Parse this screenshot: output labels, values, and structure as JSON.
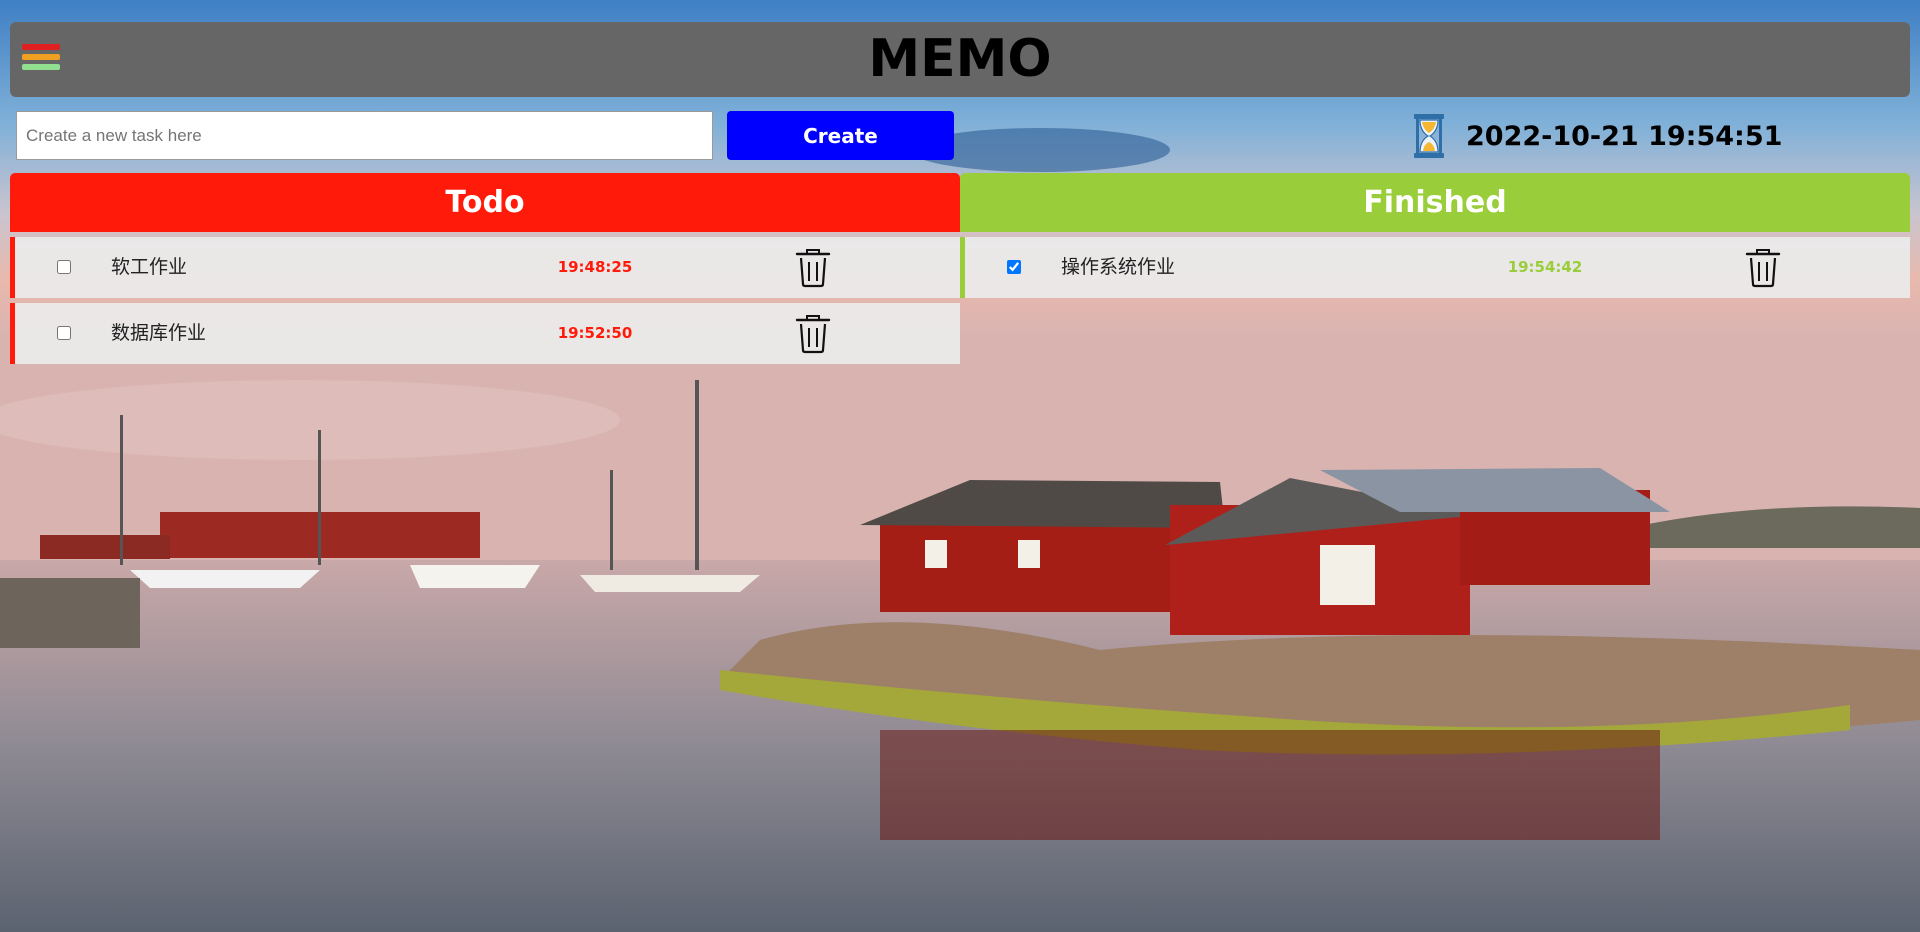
{
  "header": {
    "title": "MEMO",
    "menu_icon": "hamburger-menu-icon"
  },
  "new_task": {
    "placeholder": "Create a new task here",
    "value": ""
  },
  "create_button": {
    "label": "Create"
  },
  "clock": {
    "icon": "hourglass-icon",
    "datetime": "2022-10-21 19:54:51"
  },
  "columns": {
    "todo": {
      "title": "Todo",
      "color": "#ff1a0a"
    },
    "finished": {
      "title": "Finished",
      "color": "#9acd3a"
    }
  },
  "todo_tasks": [
    {
      "name": "软工作业",
      "time": "19:48:25",
      "checked": false
    },
    {
      "name": "数据库作业",
      "time": "19:52:50",
      "checked": false
    }
  ],
  "finished_tasks": [
    {
      "name": "操作系统作业",
      "time": "19:54:42",
      "checked": true
    }
  ],
  "colors": {
    "header_bg": "#666666",
    "create_button": "#0000ff",
    "menu_bars": [
      "#e02020",
      "#f0a020",
      "#90e090"
    ]
  }
}
